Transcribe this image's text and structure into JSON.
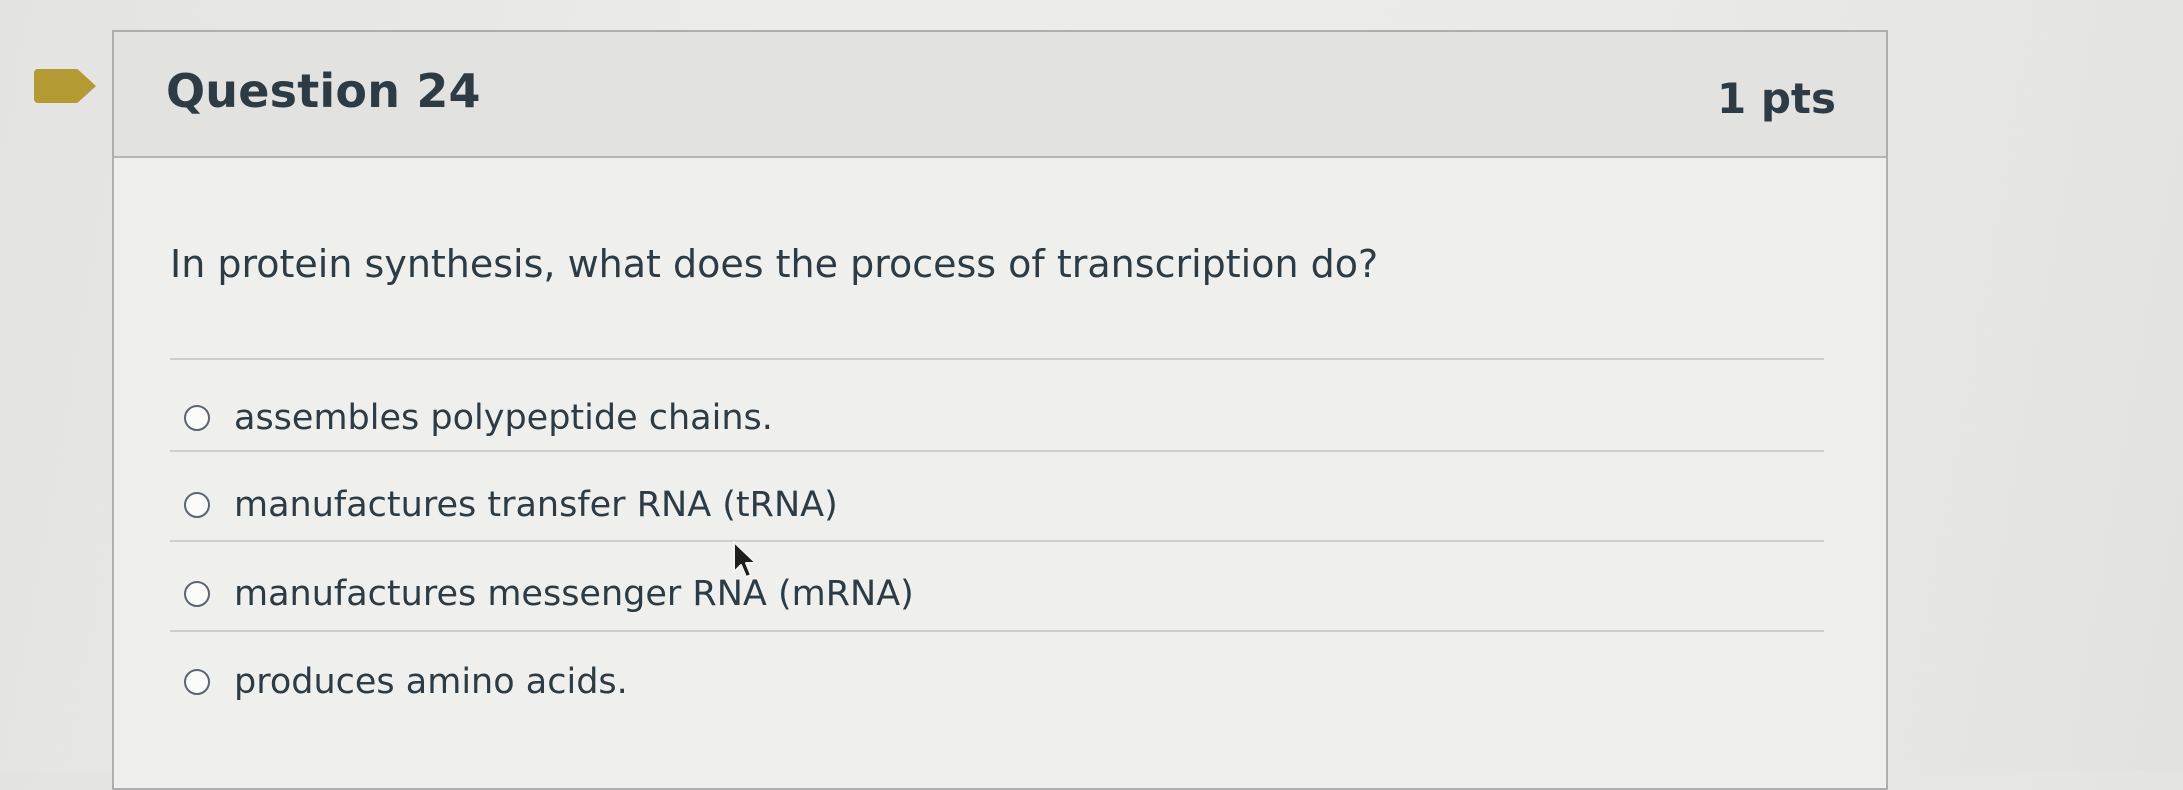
{
  "question": {
    "title": "Question 24",
    "points": "1 pts",
    "text": "In protein synthesis, what does the process of transcription do?",
    "answers": [
      {
        "label": "assembles polypeptide chains.",
        "selected": false
      },
      {
        "label": "manufactures transfer RNA (tRNA)",
        "selected": false
      },
      {
        "label": "manufactures messenger RNA (mRNA)",
        "selected": false
      },
      {
        "label": "produces amino acids.",
        "selected": false
      }
    ]
  },
  "colors": {
    "bookmark": "#b49a33",
    "text": "#2d3b45",
    "header_bg": "#e2e2e1"
  },
  "icons": {
    "bookmark": "bookmark-flag-icon",
    "cursor": "mouse-pointer-icon"
  }
}
